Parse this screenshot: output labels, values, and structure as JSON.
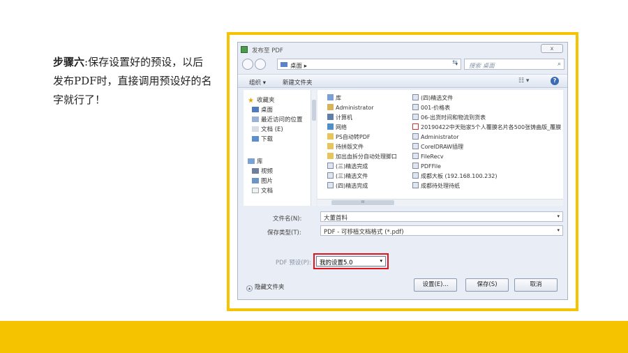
{
  "instruction": {
    "step": "步骤六",
    "text": ":保存设置好的预设，以后发布PDF时，直接调用预设好的名字就行了！"
  },
  "dialog": {
    "title": "发布至 PDF",
    "close": "ⅹ",
    "address": {
      "crumb": "桌面 ▸"
    },
    "search_placeholder": "搜索 桌面",
    "toolbar": {
      "organize": "组织 ▾",
      "new_folder": "新建文件夹",
      "view": "☷ ▾",
      "help": "?"
    },
    "nav_items": [
      {
        "label": "收藏夹",
        "icon": "star-icon"
      },
      {
        "label": "桌面",
        "icon": "desktop-icon"
      },
      {
        "label": "最近访问的位置",
        "icon": "recent-icon"
      },
      {
        "label": "文档 (E)",
        "icon": "drive-icon"
      },
      {
        "label": "下载",
        "icon": "download-icon"
      },
      {
        "label": "库",
        "icon": "library-icon"
      },
      {
        "label": "视频",
        "icon": "video-icon"
      },
      {
        "label": "图片",
        "icon": "picture-icon"
      },
      {
        "label": "文档",
        "icon": "document-icon"
      }
    ],
    "files_col1": [
      {
        "label": "库",
        "icon": "library-icon"
      },
      {
        "label": "Administrator",
        "icon": "user-icon"
      },
      {
        "label": "计算机",
        "icon": "computer-icon"
      },
      {
        "label": "网络",
        "icon": "network-icon"
      },
      {
        "label": "PS自动转PDF",
        "icon": "folder-icon"
      },
      {
        "label": "待拼版文件",
        "icon": "folder-icon"
      },
      {
        "label": "加出血拆分自动处理脚口",
        "icon": "folder-icon"
      },
      {
        "label": "(三)精选完成",
        "icon": "shortcut-icon"
      },
      {
        "label": "(三)精选文件",
        "icon": "shortcut-icon"
      },
      {
        "label": "(四)精选完成",
        "icon": "shortcut-icon"
      }
    ],
    "files_col2": [
      {
        "label": "(四)精选文件",
        "icon": "shortcut-icon"
      },
      {
        "label": "001-价格表",
        "icon": "shortcut-icon"
      },
      {
        "label": "06-出货时间和物流到货表",
        "icon": "shortcut-icon"
      },
      {
        "label": "20190422中天贻家5个人覆膜名片各500张铸曲版_覆膜",
        "icon": "pdf-icon"
      },
      {
        "label": "Administrator",
        "icon": "shortcut-icon"
      },
      {
        "label": "CorelDRAW插理",
        "icon": "shortcut-icon"
      },
      {
        "label": "FileRecv",
        "icon": "shortcut-icon"
      },
      {
        "label": "PDFFile",
        "icon": "shortcut-icon"
      },
      {
        "label": "成都大板 (192.168.100.232)",
        "icon": "shortcut-icon"
      },
      {
        "label": "成都待处理待纸",
        "icon": "shortcut-icon"
      }
    ],
    "hscroll_label": "III",
    "filename_label": "文件名(N):",
    "filename_value": "大董首料",
    "filetype_label": "保存类型(T):",
    "filetype_value": "PDF - 可移植文档格式 (*.pdf)",
    "preset_label": "PDF 预设(P):",
    "preset_value": "我的设置5.0",
    "hide_folders": "隐藏文件夹",
    "buttons": {
      "settings": "设置(E)...",
      "save": "保存(S)",
      "cancel": "取消"
    }
  },
  "colors": {
    "accent_frame": "#f5c300",
    "highlight": "#e0141c"
  }
}
